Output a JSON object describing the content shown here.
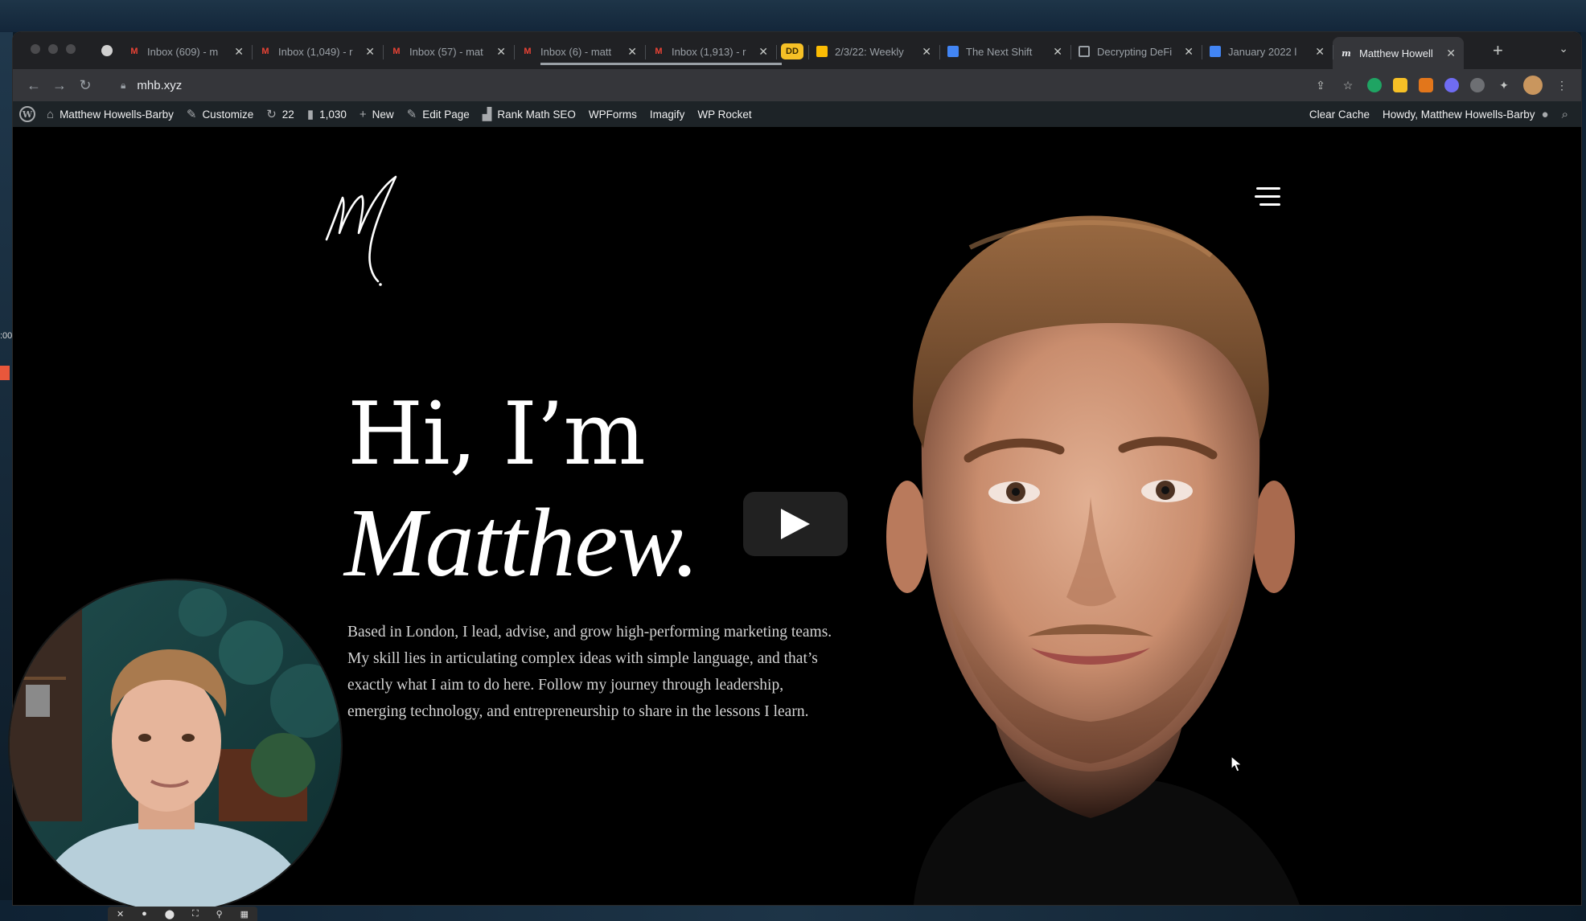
{
  "desktop": {
    "left_time": ":00"
  },
  "tabs": [
    {
      "title": "Inbox (609) - m",
      "icon": "gmail-icon"
    },
    {
      "title": "Inbox (1,049) - r",
      "icon": "gmail-icon"
    },
    {
      "title": "Inbox (57) - mat",
      "icon": "gmail-icon"
    },
    {
      "title": "Inbox (6) - matt",
      "icon": "gmail-icon"
    },
    {
      "title": "Inbox (1,913) - r",
      "icon": "gmail-icon"
    },
    {
      "title": "DD",
      "icon": "dd-badge"
    },
    {
      "title": "2/3/22: Weekly",
      "icon": "slides-icon"
    },
    {
      "title": "The Next Shift",
      "icon": "docs-icon"
    },
    {
      "title": "Decrypting DeFi",
      "icon": "calendar-icon"
    },
    {
      "title": "January 2022 l",
      "icon": "docs-icon"
    },
    {
      "title": "Matthew Howell",
      "icon": "mhb-favicon"
    }
  ],
  "toolbar": {
    "url": "mhb.xyz"
  },
  "wp_admin_bar": {
    "site_name": "Matthew Howells-Barby",
    "customize": "Customize",
    "updates": "22",
    "comments": "1,030",
    "new": "New",
    "edit_page": "Edit Page",
    "rank_math": "Rank Math SEO",
    "wpforms": "WPForms",
    "imagify": "Imagify",
    "wp_rocket": "WP Rocket",
    "clear_cache": "Clear Cache",
    "howdy": "Howdy, Matthew Howells-Barby"
  },
  "hero": {
    "line1": "Hi, I’m",
    "line2": "Matthew.",
    "bio": "Based in London, I lead, advise, and grow high-performing marketing teams. My skill lies in articulating complex ideas with simple language, and that’s exactly what I aim to do here. Follow my journey through leadership, emerging technology, and entrepreneurship to share in the lessons I learn."
  },
  "colors": {
    "page_bg": "#000000",
    "wp_bar": "#1d2327",
    "chrome_tabbar": "#202124",
    "chrome_toolbar": "#35363a"
  }
}
